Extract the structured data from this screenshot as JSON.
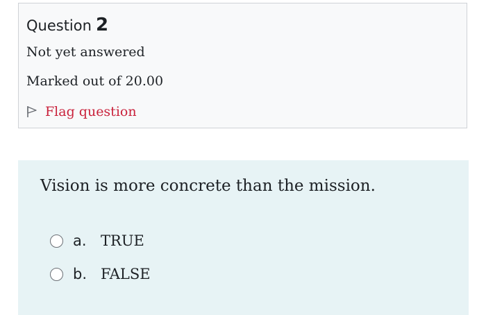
{
  "question": {
    "label": "Question",
    "number": "2",
    "state": "Not yet answered",
    "grade": "Marked out of 20.00",
    "flag_label": "Flag question",
    "flag_icon": "flag-icon"
  },
  "content": {
    "text": "Vision is more concrete than the mission.",
    "answers": [
      {
        "letter": "a.",
        "text": "TRUE",
        "selected": false
      },
      {
        "letter": "b.",
        "text": "FALSE",
        "selected": false
      }
    ]
  },
  "colors": {
    "info_bg": "#f8f9fa",
    "info_border": "#cfd2d6",
    "content_bg": "#e7f3f5",
    "flag_text": "#c9213b",
    "text": "#1d2125"
  }
}
